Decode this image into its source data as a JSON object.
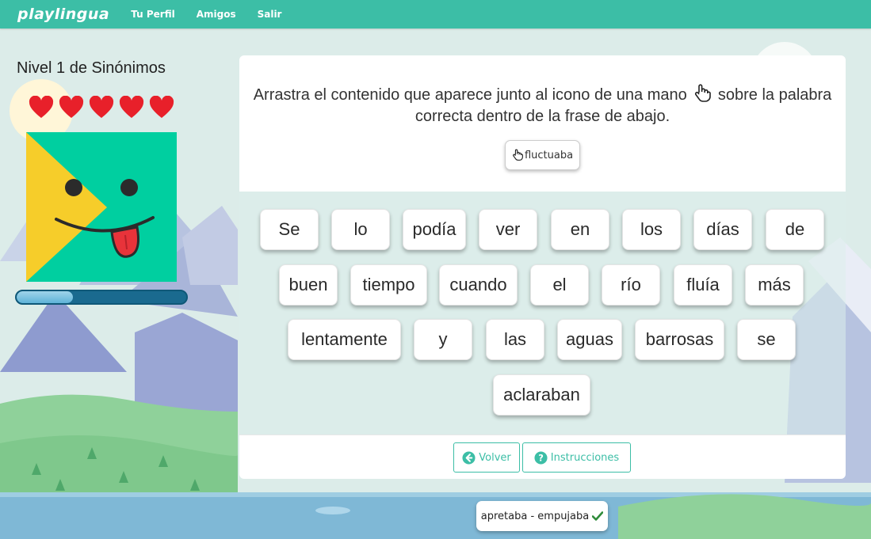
{
  "nav": {
    "logo": "playlingua",
    "links": [
      "Tu Perfil",
      "Amigos",
      "Salir"
    ]
  },
  "level": {
    "title": "Nivel 1 de Sinónimos",
    "hearts": 5,
    "progress": 0.33
  },
  "exercise": {
    "instruction_part1": "Arrastra el contenido que aparece junto al icono de una mano",
    "instruction_part2": "sobre la palabra correcta dentro de la frase de abajo.",
    "drag_word": "fluctuaba",
    "words": [
      "Se",
      "lo",
      "podía",
      "ver",
      "en",
      "los",
      "días",
      "de",
      "buen",
      "tiempo",
      "cuando",
      "el",
      "río",
      "fluía",
      "más",
      "lentamente",
      "y",
      "las",
      "aguas",
      "barrosas",
      "se",
      "aclaraban"
    ]
  },
  "buttons": {
    "back": "Volver",
    "help": "Instrucciones"
  },
  "result": {
    "text": "apretaba - empujaba"
  },
  "colors": {
    "brand": "#3cbea6",
    "heart": "#e8202a",
    "mascot_bg": "#00cfa0",
    "mascot_triangle": "#f6cd2a",
    "progress_track": "#1a6a8f",
    "check": "#2e8b3a"
  },
  "icons": {
    "hand": "hand-pointer-icon",
    "back": "arrow-circle-left-icon",
    "help": "question-circle-icon",
    "check": "check-icon"
  }
}
